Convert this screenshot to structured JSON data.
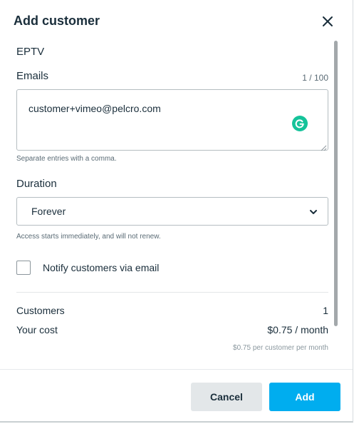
{
  "modal": {
    "title": "Add customer",
    "close_icon": "close-icon"
  },
  "form": {
    "group_name": "EPTV",
    "emails": {
      "label": "Emails",
      "counter": "1 / 100",
      "value": "customer+vimeo@pelcro.com",
      "hint": "Separate entries with a comma."
    },
    "duration": {
      "label": "Duration",
      "selected": "Forever",
      "hint": "Access starts immediately, and will not renew."
    },
    "notify": {
      "label": "Notify customers via email",
      "checked": false
    }
  },
  "summary": {
    "customers_label": "Customers",
    "customers_value": "1",
    "cost_label": "Your cost",
    "cost_value": "$0.75 / month",
    "cost_note": "$0.75 per customer per month"
  },
  "footer": {
    "cancel_label": "Cancel",
    "add_label": "Add"
  },
  "colors": {
    "primary": "#00adef",
    "secondary": "#e3e7e9",
    "grammarly": "#15c39a"
  }
}
